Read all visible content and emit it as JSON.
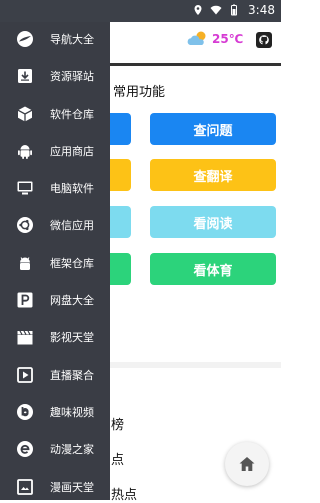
{
  "status": {
    "time": "3:48"
  },
  "header": {
    "weather_temp": "25℃"
  },
  "main": {
    "section_title": "常用功能",
    "buttons": [
      {
        "label": "查问题",
        "color": "#1a86f2"
      },
      {
        "label": "查翻译",
        "color": "#fdc216"
      },
      {
        "label": "看阅读",
        "color": "#7ddbef"
      },
      {
        "label": "看体育",
        "color": "#2cd37b"
      }
    ],
    "partial_colors": [
      "#1a86f2",
      "#fdc216",
      "#7ddbef",
      "#2cd37b"
    ],
    "list_fragments": [
      "榜",
      "点",
      "热点"
    ]
  },
  "drawer": {
    "items": [
      {
        "label": "导航大全",
        "icon": "compass-icon"
      },
      {
        "label": "资源驿站",
        "icon": "download-box-icon"
      },
      {
        "label": "软件仓库",
        "icon": "cube-icon"
      },
      {
        "label": "应用商店",
        "icon": "android-icon"
      },
      {
        "label": "电脑软件",
        "icon": "monitor-icon"
      },
      {
        "label": "微信应用",
        "icon": "ubuntu-icon"
      },
      {
        "label": "框架仓库",
        "icon": "android-robot-icon"
      },
      {
        "label": "网盘大全",
        "icon": "p-letter-icon"
      },
      {
        "label": "影视天堂",
        "icon": "clapperboard-icon"
      },
      {
        "label": "直播聚合",
        "icon": "play-box-icon"
      },
      {
        "label": "趣味视频",
        "icon": "bilibili-b-icon"
      },
      {
        "label": "动漫之家",
        "icon": "e-circle-icon"
      },
      {
        "label": "漫画天堂",
        "icon": "book-frame-icon"
      }
    ]
  }
}
